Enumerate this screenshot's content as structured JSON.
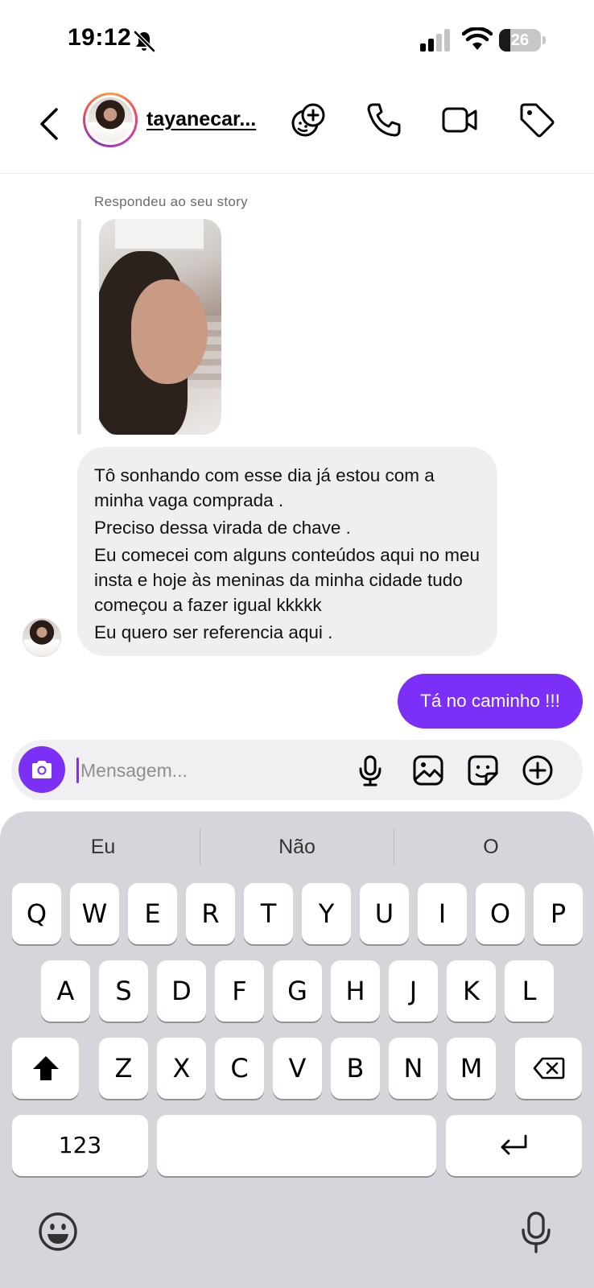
{
  "status_bar": {
    "time": "19:12",
    "battery_level": "26",
    "battery_fraction": 0.26
  },
  "header": {
    "username": "tayanecar..."
  },
  "chat": {
    "reply_label": "Respondeu ao seu story",
    "incoming_lines": [
      "Tô sonhando com esse dia já estou com a minha vaga comprada .",
      "Preciso dessa virada de chave .",
      "Eu comecei com alguns conteúdos aqui no meu insta e hoje às meninas da minha cidade tudo começou a fazer igual kkkkk",
      "Eu quero ser referencia aqui ."
    ],
    "outgoing_text": "Tá no caminho !!!"
  },
  "composer": {
    "placeholder": "Mensagem..."
  },
  "keyboard": {
    "suggestions": [
      "Eu",
      "Não",
      "O"
    ],
    "row1": [
      "Q",
      "W",
      "E",
      "R",
      "T",
      "Y",
      "U",
      "I",
      "O",
      "P"
    ],
    "row2": [
      "A",
      "S",
      "D",
      "F",
      "G",
      "H",
      "J",
      "K",
      "L"
    ],
    "row3": [
      "Z",
      "X",
      "C",
      "V",
      "B",
      "N",
      "M"
    ],
    "numbers_label": "123"
  },
  "colors": {
    "accent": "#7b2ff7",
    "incoming_bubble": "#efeff1",
    "keyboard_bg": "#d5d6db"
  },
  "icons": [
    "bell-off-icon",
    "signal-icon",
    "wifi-icon",
    "battery-icon",
    "back-arrow-icon",
    "add-effect-icon",
    "phone-icon",
    "video-icon",
    "tag-icon",
    "camera-icon",
    "microphone-icon",
    "gallery-icon",
    "sticker-icon",
    "plus-circle-icon",
    "shift-icon",
    "backspace-icon",
    "return-icon",
    "emoji-icon",
    "dictation-mic-icon"
  ]
}
